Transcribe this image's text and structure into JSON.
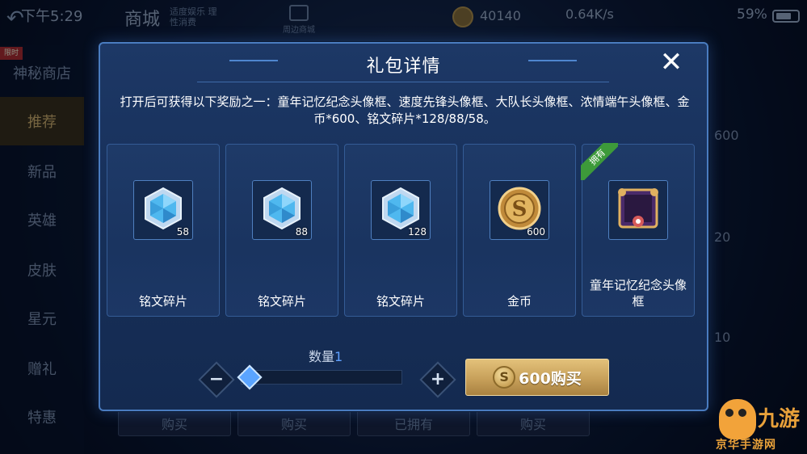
{
  "status_bar": {
    "time": "下午5:29",
    "network_speed": "0.64K/s",
    "battery_percent": "59%"
  },
  "shop": {
    "title": "商城",
    "subtitle": "适度娱乐 理性消费",
    "peripheral_label": "周边商城",
    "coins": "40140"
  },
  "sidebar": {
    "limited_tag": "限时",
    "items": [
      {
        "label": "神秘商店",
        "active": false
      },
      {
        "label": "推荐",
        "active": true
      },
      {
        "label": "新品",
        "active": false
      },
      {
        "label": "英雄",
        "active": false
      },
      {
        "label": "皮肤",
        "active": false
      },
      {
        "label": "星元",
        "active": false
      },
      {
        "label": "赠礼",
        "active": false
      },
      {
        "label": "特惠",
        "active": false
      }
    ]
  },
  "background_values": [
    "600",
    "20",
    "10"
  ],
  "background_buttons": [
    "购买",
    "购买",
    "已拥有",
    "购买"
  ],
  "modal": {
    "title": "礼包详情",
    "description": "打开后可获得以下奖励之一：童年记忆纪念头像框、速度先锋头像框、大队长头像框、浓情端午头像框、金币*600、铭文碎片*128/88/58。",
    "rewards": [
      {
        "name": "铭文碎片",
        "count": "58",
        "icon": "inscription-shard-icon",
        "owned": false
      },
      {
        "name": "铭文碎片",
        "count": "88",
        "icon": "inscription-shard-icon",
        "owned": false
      },
      {
        "name": "铭文碎片",
        "count": "128",
        "icon": "inscription-shard-icon",
        "owned": false
      },
      {
        "name": "金币",
        "count": "600",
        "icon": "gold-coin-icon",
        "owned": false
      },
      {
        "name": "童年记忆纪念头像框",
        "count": "",
        "icon": "avatar-frame-icon",
        "owned": true
      }
    ],
    "owned_label": "拥有",
    "quantity_label": "数量",
    "quantity_value": "1",
    "quantity_fraction": 0,
    "minus_symbol": "−",
    "plus_symbol": "+",
    "buy_label": "600购买",
    "close_symbol": "✕"
  },
  "watermark": {
    "text": "九游",
    "sub": "京华手游网"
  },
  "colors": {
    "modal_border": "#4a7cc0",
    "accent_blue": "#5fa0ff",
    "buy_gold": "#c7a05a",
    "owned_green": "#3d9a3a"
  }
}
